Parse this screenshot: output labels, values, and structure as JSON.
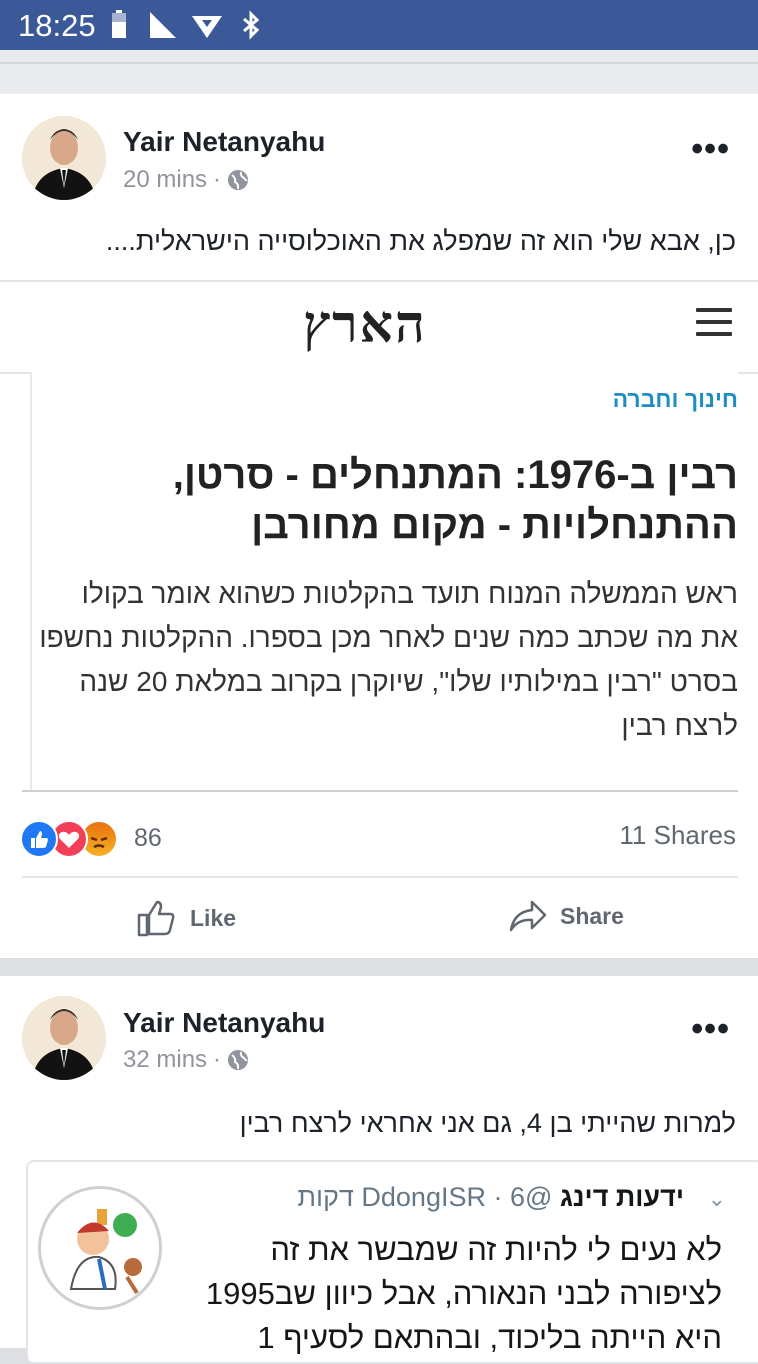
{
  "status_bar": {
    "time": "18:25"
  },
  "posts": [
    {
      "author": "Yair Netanyahu",
      "time": "20 mins",
      "separator": "·",
      "text": "כן, אבא שלי הוא זה שמפלג את האוכלוסייה הישראלית....",
      "link": {
        "site_logo": "הארץ",
        "kicker": "חינוך וחברה",
        "headline": "רבין ב-1976: המתנחלים - סרטן, ההתנחלויות - מקום מחורבן",
        "dek": "ראש הממשלה המנוח תועד בהקלטות כשהוא אומר בקולו את מה שכתב כמה שנים לאחר מכן בספרו. ההקלטות נחשפו בסרט \"רבין במילותיו שלו\", שיוקרן בקרוב במלאת 20 שנה לרצח רבין"
      },
      "reaction_count": "86",
      "shares": "11 Shares",
      "actions": {
        "like": "Like",
        "share": "Share"
      }
    },
    {
      "author": "Yair Netanyahu",
      "time": "32 mins",
      "separator": "·",
      "text": "למרות שהייתי בן 4, גם אני אחראי לרצח רבין",
      "tweet": {
        "display_name": "ידעות דינג",
        "handle": "@DdongISR",
        "time": "6 דקות",
        "text": "לא נעים לי להיות זה שמבשר את זה לציפורה לבני הנאורה, אבל כיוון שב1995 היא הייתה בליכוד, ובהתאם לסעיף 1"
      }
    }
  ],
  "colors": {
    "status_bar": "#3b5998",
    "kicker": "#1e8ec1",
    "like": "#2078f4",
    "love": "#f33e58",
    "angry": "#e9710f"
  },
  "icons": [
    "battery-icon",
    "signal-icon",
    "wifi-icon",
    "bluetooth-icon",
    "globe-icon",
    "more-icon",
    "like-icon",
    "share-icon",
    "menu-icon",
    "chevron-down-icon"
  ]
}
